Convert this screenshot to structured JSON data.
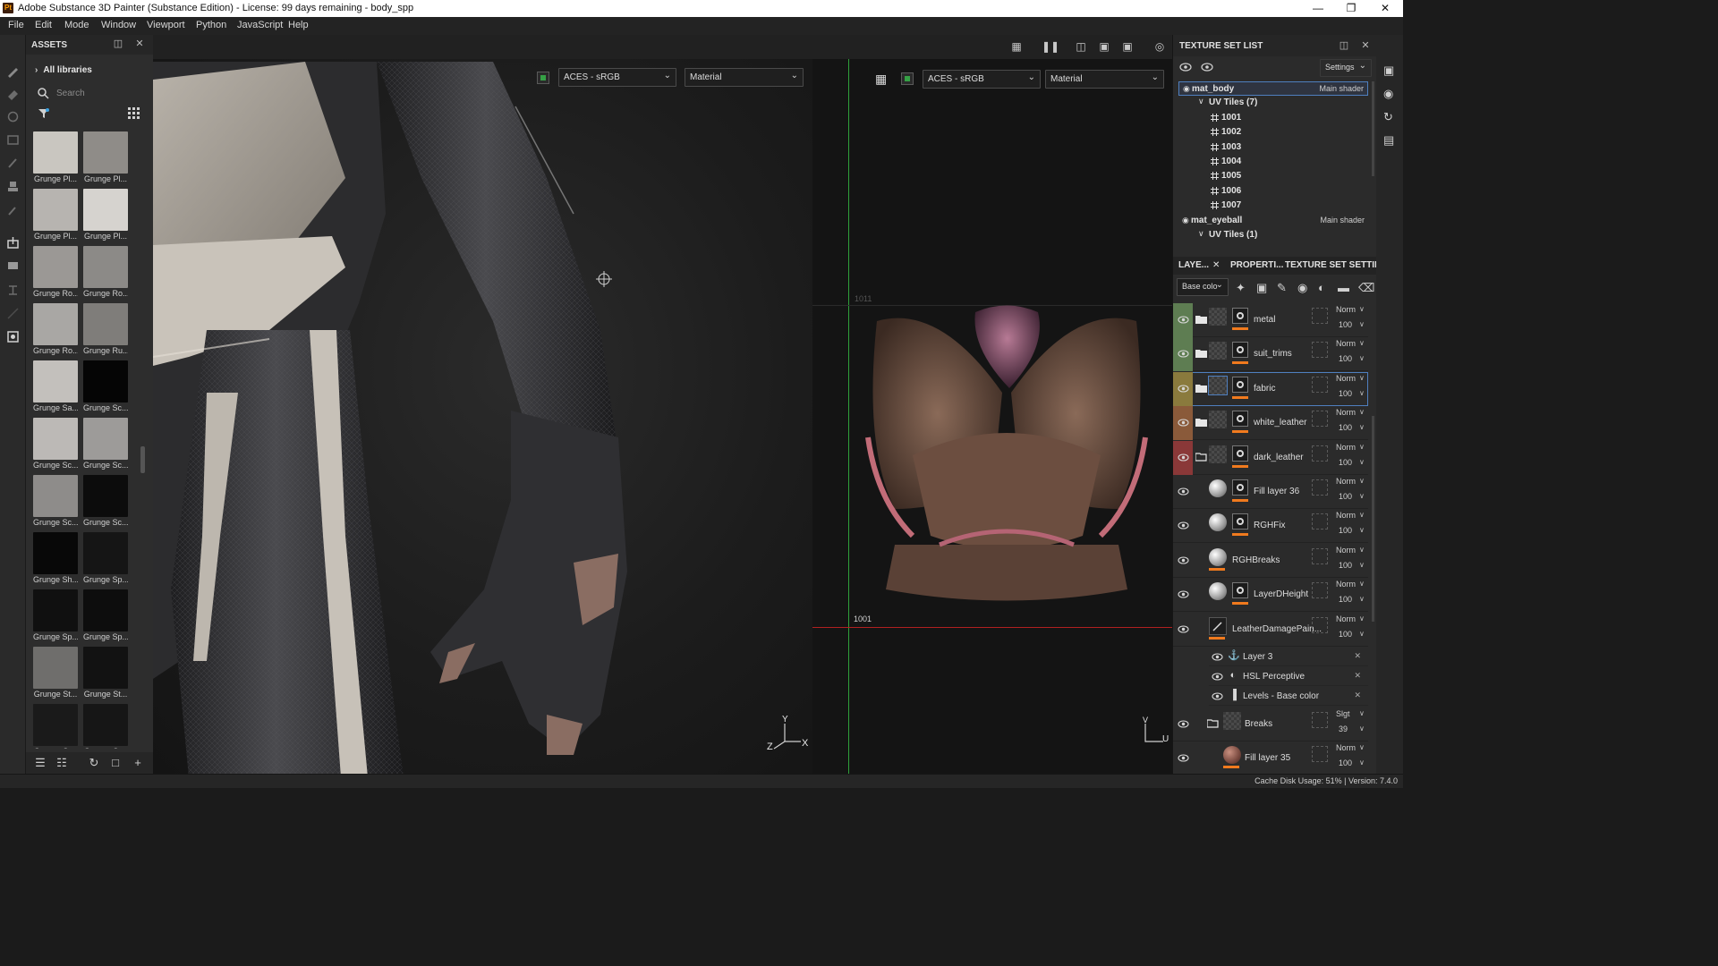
{
  "window": {
    "app_icon_text": "Pt",
    "title": "Adobe Substance 3D Painter (Substance Edition) - License: 99 days remaining - body_spp"
  },
  "menu": [
    "File",
    "Edit",
    "Mode",
    "Window",
    "Viewport",
    "Python",
    "JavaScript",
    "Help"
  ],
  "assets": {
    "title": "ASSETS",
    "library": "All libraries",
    "search_placeholder": "Search",
    "items": [
      {
        "label": "Grunge Pl...",
        "tone": "#c9c6c0"
      },
      {
        "label": "Grunge Pl...",
        "tone": "#8f8c88"
      },
      {
        "label": "Grunge Pl...",
        "tone": "#b7b4b0"
      },
      {
        "label": "Grunge Pl...",
        "tone": "#d6d3cf"
      },
      {
        "label": "Grunge Ro...",
        "tone": "#9b9895"
      },
      {
        "label": "Grunge Ro...",
        "tone": "#8c8a87"
      },
      {
        "label": "Grunge Ro...",
        "tone": "#a9a7a4"
      },
      {
        "label": "Grunge Ru...",
        "tone": "#7f7d7a"
      },
      {
        "label": "Grunge Sa...",
        "tone": "#c3c0bc"
      },
      {
        "label": "Grunge Sc...",
        "tone": "#050505"
      },
      {
        "label": "Grunge Sc...",
        "tone": "#bcb9b6"
      },
      {
        "label": "Grunge Sc...",
        "tone": "#9d9b99"
      },
      {
        "label": "Grunge Sc...",
        "tone": "#8e8c8a"
      },
      {
        "label": "Grunge Sc...",
        "tone": "#0c0c0c"
      },
      {
        "label": "Grunge Sh...",
        "tone": "#080808"
      },
      {
        "label": "Grunge Sp...",
        "tone": "#151515"
      },
      {
        "label": "Grunge Sp...",
        "tone": "#101010"
      },
      {
        "label": "Grunge Sp...",
        "tone": "#0d0d0d"
      },
      {
        "label": "Grunge St...",
        "tone": "#6f6e6c"
      },
      {
        "label": "Grunge St...",
        "tone": "#121212"
      },
      {
        "label": "Grunge St...",
        "tone": "#1a1a1a"
      },
      {
        "label": "Grunge St...",
        "tone": "#161616"
      }
    ]
  },
  "viewport": {
    "left_colorspace": "ACES - sRGB",
    "left_mode": "Material",
    "right_colorspace": "ACES - sRGB",
    "right_mode": "Material",
    "uv_tile_top": "1011",
    "uv_tile_bottom": "1001",
    "axis_3d": {
      "y": "Y",
      "z": "Z",
      "x": "X"
    },
    "axis_2d": {
      "v": "V",
      "u": "U"
    }
  },
  "texture_set_list": {
    "title": "TEXTURE SET LIST",
    "settings_label": "Settings",
    "rows": [
      {
        "type": "set",
        "label": "mat_body",
        "right": "Main shader"
      },
      {
        "type": "uv",
        "label": "UV Tiles (7)"
      },
      {
        "type": "tile",
        "label": "1001"
      },
      {
        "type": "tile",
        "label": "1002"
      },
      {
        "type": "tile",
        "label": "1003"
      },
      {
        "type": "tile",
        "label": "1004"
      },
      {
        "type": "tile",
        "label": "1005"
      },
      {
        "type": "tile",
        "label": "1006"
      },
      {
        "type": "tile",
        "label": "1007"
      },
      {
        "type": "set",
        "label": "mat_eyeball",
        "right": "Main shader"
      },
      {
        "type": "uv",
        "label": "UV Tiles (1)"
      }
    ]
  },
  "tabs": [
    "LAYE...",
    "PROPERTI...",
    "TEXTURE SET SETTIN..."
  ],
  "layers": {
    "channel": "Base colo",
    "items": [
      {
        "name": "metal",
        "kind": "folder",
        "color": "#5e7d52",
        "blend": "Norm",
        "opacity": "100",
        "mask": true
      },
      {
        "name": "suit_trims",
        "kind": "folder",
        "color": "#5e7d52",
        "blend": "Norm",
        "opacity": "100",
        "mask": true
      },
      {
        "name": "fabric",
        "kind": "folder",
        "color": "#8a7a3d",
        "blend": "Norm",
        "opacity": "100",
        "mask": true,
        "selected": true
      },
      {
        "name": "white_leather",
        "kind": "folder",
        "color": "#8a5a3a",
        "blend": "Norm",
        "opacity": "100",
        "mask": true
      },
      {
        "name": "dark_leather",
        "kind": "folder-open",
        "color": "#8a3838",
        "blend": "Norm",
        "opacity": "100",
        "mask": true
      },
      {
        "name": "Fill layer 36",
        "kind": "fill",
        "color": "",
        "blend": "Norm",
        "opacity": "100",
        "mask": true
      },
      {
        "name": "RGHFix",
        "kind": "fill",
        "color": "",
        "blend": "Norm",
        "opacity": "100",
        "mask": true
      },
      {
        "name": "RGHBreaks",
        "kind": "fill",
        "color": "",
        "blend": "Norm",
        "opacity": "100",
        "mask": false
      },
      {
        "name": "LayerDHeight",
        "kind": "fill",
        "color": "",
        "blend": "Norm",
        "opacity": "100",
        "mask": true
      },
      {
        "name": "LeatherDamagePain...",
        "kind": "paint",
        "color": "",
        "blend": "Norm",
        "opacity": "100",
        "mask": false
      }
    ],
    "effects": [
      {
        "name": "Layer 3",
        "icon": "anchor"
      },
      {
        "name": "HSL Perceptive",
        "icon": "filter"
      },
      {
        "name": "Levels - Base color",
        "icon": "levels"
      }
    ],
    "tail": [
      {
        "name": "Breaks",
        "kind": "subfolder",
        "blend": "Slgt",
        "opacity": "39"
      },
      {
        "name": "Fill layer 35",
        "kind": "subfill",
        "blend": "Norm",
        "opacity": "100"
      }
    ]
  },
  "status": {
    "text": "Cache Disk Usage:  51% | Version: 7.4.0"
  },
  "colors": {
    "accent": "#f07a1e",
    "selection": "#4f7fbf",
    "uv_v_axis": "#2fa03a",
    "uv_u_axis": "#b12020"
  }
}
